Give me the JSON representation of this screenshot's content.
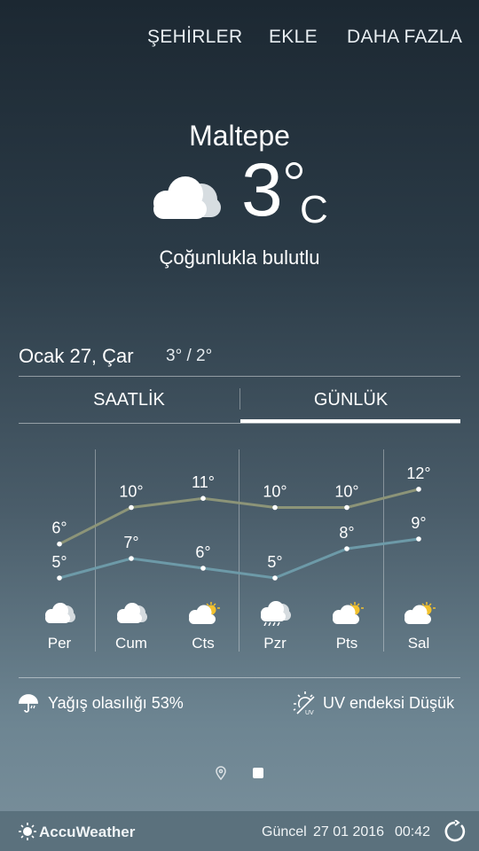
{
  "nav": {
    "cities": "ŞEHİRLER",
    "add": "EKLE",
    "more": "DAHA FAZLA"
  },
  "current": {
    "city": "Maltepe",
    "temp": "3",
    "unit": "C",
    "condition": "Çoğunlukla bulutlu",
    "icon": "cloud-icon"
  },
  "today": {
    "date": "Ocak 27, Çar",
    "hilo": "3° / 2°"
  },
  "tabs": {
    "hourly": "SAATLİK",
    "daily": "GÜNLÜK",
    "active": "daily"
  },
  "forecast": [
    {
      "day": "Per",
      "high": "6°",
      "low": "5°",
      "icon": "cloudy-icon"
    },
    {
      "day": "Cum",
      "high": "10°",
      "low": "7°",
      "icon": "cloudy-icon"
    },
    {
      "day": "Cts",
      "high": "11°",
      "low": "6°",
      "icon": "partly-sunny-icon"
    },
    {
      "day": "Pzr",
      "high": "10°",
      "low": "5°",
      "icon": "rain-cloud-icon"
    },
    {
      "day": "Pts",
      "high": "10°",
      "low": "8°",
      "icon": "partly-sunny-icon"
    },
    {
      "day": "Sal",
      "high": "12°",
      "low": "9°",
      "icon": "partly-sunny-icon"
    }
  ],
  "chart_data": {
    "type": "line",
    "categories": [
      "Per",
      "Cum",
      "Cts",
      "Pzr",
      "Pts",
      "Sal"
    ],
    "series": [
      {
        "values": [
          6,
          10,
          11,
          10,
          10,
          12
        ],
        "color": "#8c9478"
      },
      {
        "values": [
          5,
          7,
          6,
          5,
          8,
          9
        ],
        "color": "#6d9aa8"
      }
    ]
  },
  "info": {
    "precip": "Yağış olasılığı 53%",
    "uv": "UV endeksi Düşük",
    "uv_badge": "UV"
  },
  "footer": {
    "brand": "AccuWeather",
    "updated_label": "Güncel",
    "updated_date": "27 01 2016",
    "updated_time": "00:42"
  }
}
